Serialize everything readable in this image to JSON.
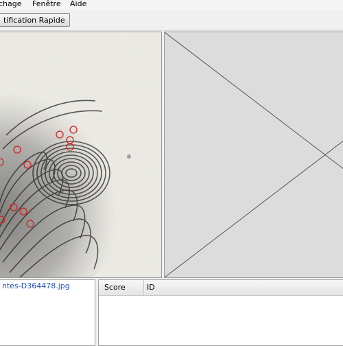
{
  "menu": {
    "items": [
      "chage",
      "Fenêtre",
      "Aide"
    ]
  },
  "toolbar": {
    "quick_id_label": "tification Rapide"
  },
  "image_panel": {
    "marker_color": "#d42020",
    "icon": "fingerprint-image",
    "minutiae_count": 16
  },
  "match_panel": {
    "icon": "empty-placeholder-cross"
  },
  "file_list": {
    "selected_file": "ntes-D364478.jpg",
    "link_color": "#1f4fbf"
  },
  "results_table": {
    "columns": [
      "Score",
      "ID"
    ],
    "rows": []
  }
}
